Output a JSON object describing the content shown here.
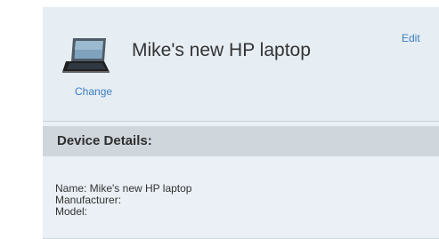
{
  "device": {
    "title": "Mike's new HP laptop",
    "change_label": "Change",
    "edit_label": "Edit",
    "icon": "laptop-icon"
  },
  "details": {
    "heading": "Device Details:",
    "rows": [
      {
        "text": "Name: Mike's new HP laptop"
      },
      {
        "text": "Manufacturer:"
      },
      {
        "text": "Model:"
      }
    ]
  },
  "colors": {
    "link": "#3a7dbf",
    "panel": "#eaf0f5",
    "details_bar": "#cfd6dc",
    "text": "#333333"
  }
}
